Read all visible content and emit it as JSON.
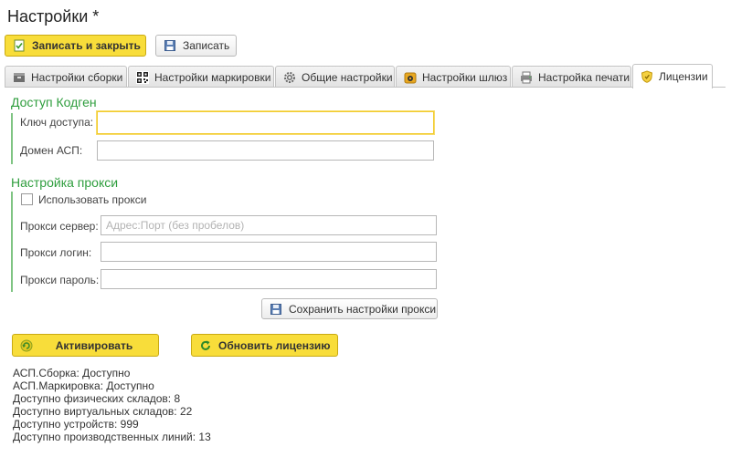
{
  "window": {
    "title": "Настройки *"
  },
  "toolbar": {
    "save_close_label": "Записать и закрыть",
    "save_label": "Записать"
  },
  "tabs": [
    {
      "label": "Настройки сборки",
      "icon": "box-icon"
    },
    {
      "label": "Настройки маркировки",
      "icon": "qr-code-icon"
    },
    {
      "label": "Общие настройки",
      "icon": "gear-icon"
    },
    {
      "label": "Настройки шлюз",
      "icon": "gateway-icon"
    },
    {
      "label": "Настройка печати",
      "icon": "printer-icon"
    },
    {
      "label": "Лицензии",
      "icon": "shield-icon",
      "active": true
    }
  ],
  "access": {
    "title": "Доступ Кодген",
    "key_label": "Ключ доступа:",
    "key_value": "",
    "domain_label": "Домен АСП:",
    "domain_value": ""
  },
  "proxy": {
    "title": "Настройка прокси",
    "use_proxy_label": "Использовать прокси",
    "use_proxy_checked": false,
    "server_label": "Прокси сервер:",
    "server_placeholder": "Адрес:Порт (без пробелов)",
    "login_label": "Прокси логин:",
    "password_label": "Прокси пароль:",
    "save_button_label": "Сохранить настройки прокси"
  },
  "actions": {
    "activate_label": "Активировать",
    "refresh_label": "Обновить лицензию"
  },
  "license_info": [
    "АСП.Сборка: Доступно",
    "АСП.Маркировка: Доступно",
    "Доступно физических складов: 8",
    "Доступно виртуальных складов: 22",
    "Доступно устройств: 999",
    "Доступно производственных линий: 13"
  ],
  "colors": {
    "accent_yellow": "#f8dd3a",
    "section_green": "#2f9e3e",
    "focus_yellow": "#f2cc2e"
  }
}
